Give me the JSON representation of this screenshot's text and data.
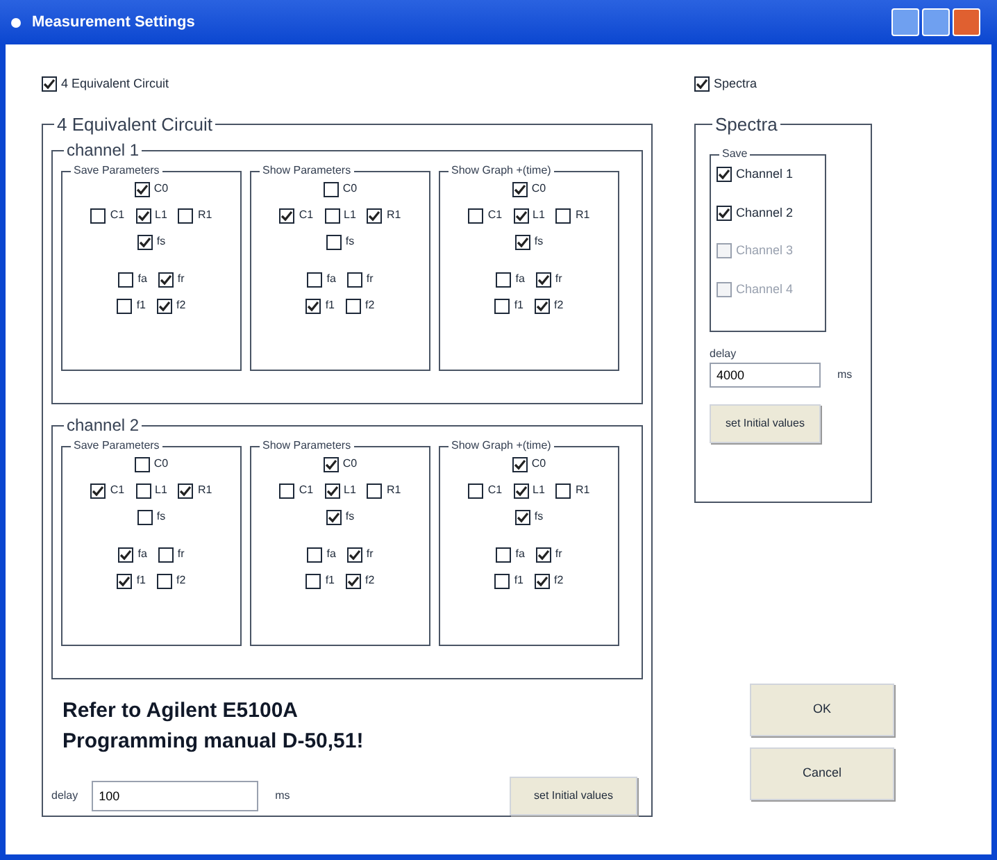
{
  "window": {
    "title": "Measurement Settings"
  },
  "equivalent_toggle": {
    "label": "4 Equivalent Circuit",
    "checked": true
  },
  "spectra_toggle": {
    "label": "Spectra",
    "checked": true
  },
  "equivalent": {
    "title": "4 Equivalent Circuit",
    "channels": [
      {
        "title": "channel 1",
        "groups": [
          {
            "title": "Save Parameters",
            "params": [
              {
                "label": "C0",
                "checked": true
              },
              {
                "label": "C1",
                "checked": false
              },
              {
                "label": "L1",
                "checked": true
              },
              {
                "label": "R1",
                "checked": false
              },
              {
                "label": "fs",
                "checked": true
              },
              {
                "label": "fa",
                "checked": false
              },
              {
                "label": "fr",
                "checked": true
              },
              {
                "label": "f1",
                "checked": false
              },
              {
                "label": "f2",
                "checked": true
              }
            ]
          },
          {
            "title": "Show Parameters",
            "params": [
              {
                "label": "C0",
                "checked": false
              },
              {
                "label": "C1",
                "checked": true
              },
              {
                "label": "L1",
                "checked": false
              },
              {
                "label": "R1",
                "checked": true
              },
              {
                "label": "fs",
                "checked": false
              },
              {
                "label": "fa",
                "checked": false
              },
              {
                "label": "fr",
                "checked": false
              },
              {
                "label": "f1",
                "checked": true
              },
              {
                "label": "f2",
                "checked": false
              }
            ]
          },
          {
            "title": "Show Graph +(time)",
            "params": [
              {
                "label": "C0",
                "checked": true
              },
              {
                "label": "C1",
                "checked": false
              },
              {
                "label": "L1",
                "checked": true
              },
              {
                "label": "R1",
                "checked": false
              },
              {
                "label": "fs",
                "checked": true
              },
              {
                "label": "fa",
                "checked": false
              },
              {
                "label": "fr",
                "checked": true
              },
              {
                "label": "f1",
                "checked": false
              },
              {
                "label": "f2",
                "checked": true
              }
            ]
          }
        ]
      },
      {
        "title": "channel 2",
        "groups": [
          {
            "title": "Save Parameters",
            "params": [
              {
                "label": "C0",
                "checked": false
              },
              {
                "label": "C1",
                "checked": true
              },
              {
                "label": "L1",
                "checked": false
              },
              {
                "label": "R1",
                "checked": true
              },
              {
                "label": "fs",
                "checked": false
              },
              {
                "label": "fa",
                "checked": true
              },
              {
                "label": "fr",
                "checked": false
              },
              {
                "label": "f1",
                "checked": true
              },
              {
                "label": "f2",
                "checked": false
              }
            ]
          },
          {
            "title": "Show Parameters",
            "params": [
              {
                "label": "C0",
                "checked": true
              },
              {
                "label": "C1",
                "checked": false
              },
              {
                "label": "L1",
                "checked": true
              },
              {
                "label": "R1",
                "checked": false
              },
              {
                "label": "fs",
                "checked": true
              },
              {
                "label": "fa",
                "checked": false
              },
              {
                "label": "fr",
                "checked": true
              },
              {
                "label": "f1",
                "checked": false
              },
              {
                "label": "f2",
                "checked": true
              }
            ]
          },
          {
            "title": "Show Graph +(time)",
            "params": [
              {
                "label": "C0",
                "checked": true
              },
              {
                "label": "C1",
                "checked": false
              },
              {
                "label": "L1",
                "checked": true
              },
              {
                "label": "R1",
                "checked": false
              },
              {
                "label": "fs",
                "checked": true
              },
              {
                "label": "fa",
                "checked": false
              },
              {
                "label": "fr",
                "checked": true
              },
              {
                "label": "f1",
                "checked": false
              },
              {
                "label": "f2",
                "checked": true
              }
            ]
          }
        ]
      }
    ],
    "note_lines": [
      "Refer to Agilent E5100A",
      "Programming manual D-50,51!"
    ],
    "delay_label": "delay",
    "delay_value": "100",
    "delay_unit": "ms",
    "init_button": "set Initial values"
  },
  "spectra": {
    "title": "Spectra",
    "save_title": "Save",
    "channels": [
      {
        "label": "Channel 1",
        "checked": true,
        "disabled": false
      },
      {
        "label": "Channel 2",
        "checked": true,
        "disabled": false
      },
      {
        "label": "Channel 3",
        "checked": false,
        "disabled": true
      },
      {
        "label": "Channel 4",
        "checked": false,
        "disabled": true
      }
    ],
    "delay_label": "delay",
    "delay_value": "4000",
    "delay_unit": "ms",
    "init_button": "set Initial values"
  },
  "buttons": [
    "OK",
    "Cancel"
  ]
}
